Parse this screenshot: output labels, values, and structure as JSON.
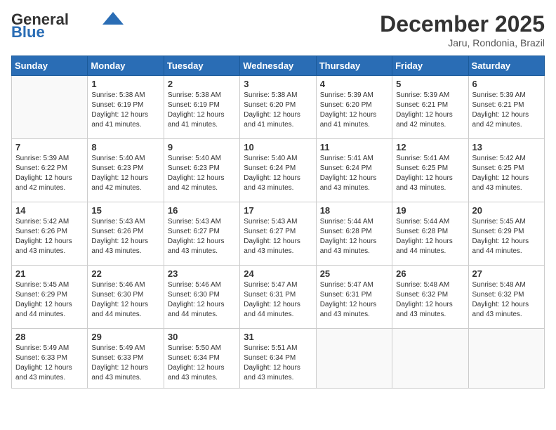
{
  "logo": {
    "general": "General",
    "blue": "Blue"
  },
  "header": {
    "title": "December 2025",
    "location": "Jaru, Rondonia, Brazil"
  },
  "weekdays": [
    "Sunday",
    "Monday",
    "Tuesday",
    "Wednesday",
    "Thursday",
    "Friday",
    "Saturday"
  ],
  "weeks": [
    [
      {
        "day": "",
        "info": ""
      },
      {
        "day": "1",
        "info": "Sunrise: 5:38 AM\nSunset: 6:19 PM\nDaylight: 12 hours\nand 41 minutes."
      },
      {
        "day": "2",
        "info": "Sunrise: 5:38 AM\nSunset: 6:19 PM\nDaylight: 12 hours\nand 41 minutes."
      },
      {
        "day": "3",
        "info": "Sunrise: 5:38 AM\nSunset: 6:20 PM\nDaylight: 12 hours\nand 41 minutes."
      },
      {
        "day": "4",
        "info": "Sunrise: 5:39 AM\nSunset: 6:20 PM\nDaylight: 12 hours\nand 41 minutes."
      },
      {
        "day": "5",
        "info": "Sunrise: 5:39 AM\nSunset: 6:21 PM\nDaylight: 12 hours\nand 42 minutes."
      },
      {
        "day": "6",
        "info": "Sunrise: 5:39 AM\nSunset: 6:21 PM\nDaylight: 12 hours\nand 42 minutes."
      }
    ],
    [
      {
        "day": "7",
        "info": "Sunrise: 5:39 AM\nSunset: 6:22 PM\nDaylight: 12 hours\nand 42 minutes."
      },
      {
        "day": "8",
        "info": "Sunrise: 5:40 AM\nSunset: 6:23 PM\nDaylight: 12 hours\nand 42 minutes."
      },
      {
        "day": "9",
        "info": "Sunrise: 5:40 AM\nSunset: 6:23 PM\nDaylight: 12 hours\nand 42 minutes."
      },
      {
        "day": "10",
        "info": "Sunrise: 5:40 AM\nSunset: 6:24 PM\nDaylight: 12 hours\nand 43 minutes."
      },
      {
        "day": "11",
        "info": "Sunrise: 5:41 AM\nSunset: 6:24 PM\nDaylight: 12 hours\nand 43 minutes."
      },
      {
        "day": "12",
        "info": "Sunrise: 5:41 AM\nSunset: 6:25 PM\nDaylight: 12 hours\nand 43 minutes."
      },
      {
        "day": "13",
        "info": "Sunrise: 5:42 AM\nSunset: 6:25 PM\nDaylight: 12 hours\nand 43 minutes."
      }
    ],
    [
      {
        "day": "14",
        "info": "Sunrise: 5:42 AM\nSunset: 6:26 PM\nDaylight: 12 hours\nand 43 minutes."
      },
      {
        "day": "15",
        "info": "Sunrise: 5:43 AM\nSunset: 6:26 PM\nDaylight: 12 hours\nand 43 minutes."
      },
      {
        "day": "16",
        "info": "Sunrise: 5:43 AM\nSunset: 6:27 PM\nDaylight: 12 hours\nand 43 minutes."
      },
      {
        "day": "17",
        "info": "Sunrise: 5:43 AM\nSunset: 6:27 PM\nDaylight: 12 hours\nand 43 minutes."
      },
      {
        "day": "18",
        "info": "Sunrise: 5:44 AM\nSunset: 6:28 PM\nDaylight: 12 hours\nand 43 minutes."
      },
      {
        "day": "19",
        "info": "Sunrise: 5:44 AM\nSunset: 6:28 PM\nDaylight: 12 hours\nand 44 minutes."
      },
      {
        "day": "20",
        "info": "Sunrise: 5:45 AM\nSunset: 6:29 PM\nDaylight: 12 hours\nand 44 minutes."
      }
    ],
    [
      {
        "day": "21",
        "info": "Sunrise: 5:45 AM\nSunset: 6:29 PM\nDaylight: 12 hours\nand 44 minutes."
      },
      {
        "day": "22",
        "info": "Sunrise: 5:46 AM\nSunset: 6:30 PM\nDaylight: 12 hours\nand 44 minutes."
      },
      {
        "day": "23",
        "info": "Sunrise: 5:46 AM\nSunset: 6:30 PM\nDaylight: 12 hours\nand 44 minutes."
      },
      {
        "day": "24",
        "info": "Sunrise: 5:47 AM\nSunset: 6:31 PM\nDaylight: 12 hours\nand 44 minutes."
      },
      {
        "day": "25",
        "info": "Sunrise: 5:47 AM\nSunset: 6:31 PM\nDaylight: 12 hours\nand 43 minutes."
      },
      {
        "day": "26",
        "info": "Sunrise: 5:48 AM\nSunset: 6:32 PM\nDaylight: 12 hours\nand 43 minutes."
      },
      {
        "day": "27",
        "info": "Sunrise: 5:48 AM\nSunset: 6:32 PM\nDaylight: 12 hours\nand 43 minutes."
      }
    ],
    [
      {
        "day": "28",
        "info": "Sunrise: 5:49 AM\nSunset: 6:33 PM\nDaylight: 12 hours\nand 43 minutes."
      },
      {
        "day": "29",
        "info": "Sunrise: 5:49 AM\nSunset: 6:33 PM\nDaylight: 12 hours\nand 43 minutes."
      },
      {
        "day": "30",
        "info": "Sunrise: 5:50 AM\nSunset: 6:34 PM\nDaylight: 12 hours\nand 43 minutes."
      },
      {
        "day": "31",
        "info": "Sunrise: 5:51 AM\nSunset: 6:34 PM\nDaylight: 12 hours\nand 43 minutes."
      },
      {
        "day": "",
        "info": ""
      },
      {
        "day": "",
        "info": ""
      },
      {
        "day": "",
        "info": ""
      }
    ]
  ]
}
